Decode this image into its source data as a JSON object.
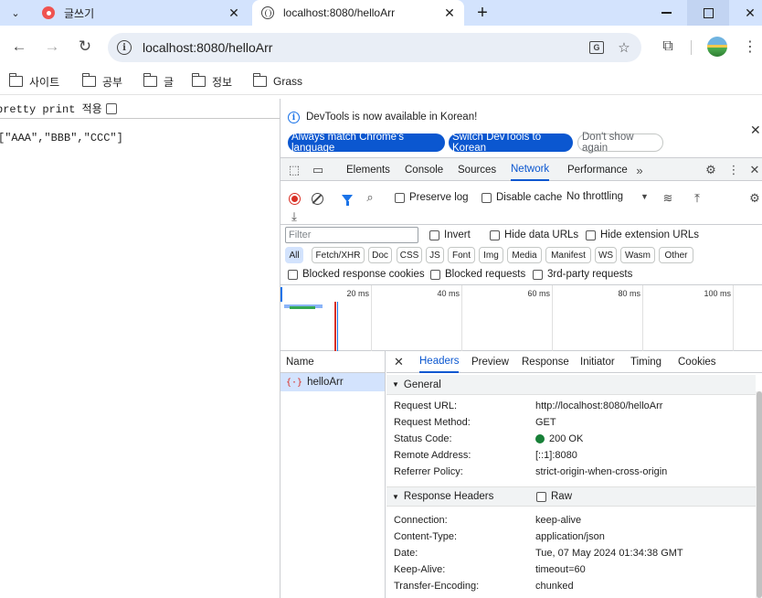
{
  "tabs": [
    {
      "title": "글쓰기",
      "active": false
    },
    {
      "title": "localhost:8080/helloArr",
      "active": true
    }
  ],
  "toolbar": {
    "url": "localhost:8080/helloArr"
  },
  "bookmarks": [
    "사이트",
    "공부",
    "글",
    "정보",
    "Grass"
  ],
  "page": {
    "pretty_print_label": "pretty print 적용",
    "json_output": "[\"AAA\",\"BBB\",\"CCC\"]"
  },
  "devtools": {
    "infobar": {
      "message": "DevTools is now available in Korean!",
      "btn_match": "Always match Chrome's language",
      "btn_switch": "Switch DevTools to Korean",
      "btn_dismiss": "Don't show again"
    },
    "panels": [
      "Elements",
      "Console",
      "Sources",
      "Network",
      "Performance"
    ],
    "active_panel": "Network",
    "network": {
      "preserve_log": "Preserve log",
      "disable_cache": "Disable cache",
      "throttling": "No throttling",
      "filter_placeholder": "Filter",
      "invert": "Invert",
      "hide_data_urls": "Hide data URLs",
      "hide_extension_urls": "Hide extension URLs",
      "types": [
        "All",
        "Fetch/XHR",
        "Doc",
        "CSS",
        "JS",
        "Font",
        "Img",
        "Media",
        "Manifest",
        "WS",
        "Wasm",
        "Other"
      ],
      "blocked_response_cookies": "Blocked response cookies",
      "blocked_requests": "Blocked requests",
      "third_party": "3rd-party requests",
      "timeline_ticks": [
        "20 ms",
        "40 ms",
        "60 ms",
        "80 ms",
        "100 ms"
      ]
    },
    "requests": {
      "header": "Name",
      "items": [
        "helloArr"
      ]
    },
    "detail": {
      "tabs": [
        "Headers",
        "Preview",
        "Response",
        "Initiator",
        "Timing",
        "Cookies"
      ],
      "general_title": "General",
      "general": [
        {
          "key": "Request URL:",
          "value": "http://localhost:8080/helloArr"
        },
        {
          "key": "Request Method:",
          "value": "GET"
        },
        {
          "key": "Status Code:",
          "value": "200 OK"
        },
        {
          "key": "Remote Address:",
          "value": "[::1]:8080"
        },
        {
          "key": "Referrer Policy:",
          "value": "strict-origin-when-cross-origin"
        }
      ],
      "response_title": "Response Headers",
      "raw_label": "Raw",
      "response": [
        {
          "key": "Connection:",
          "value": "keep-alive"
        },
        {
          "key": "Content-Type:",
          "value": "application/json"
        },
        {
          "key": "Date:",
          "value": "Tue, 07 May 2024 01:34:38 GMT"
        },
        {
          "key": "Keep-Alive:",
          "value": "timeout=60"
        },
        {
          "key": "Transfer-Encoding:",
          "value": "chunked"
        }
      ]
    }
  }
}
